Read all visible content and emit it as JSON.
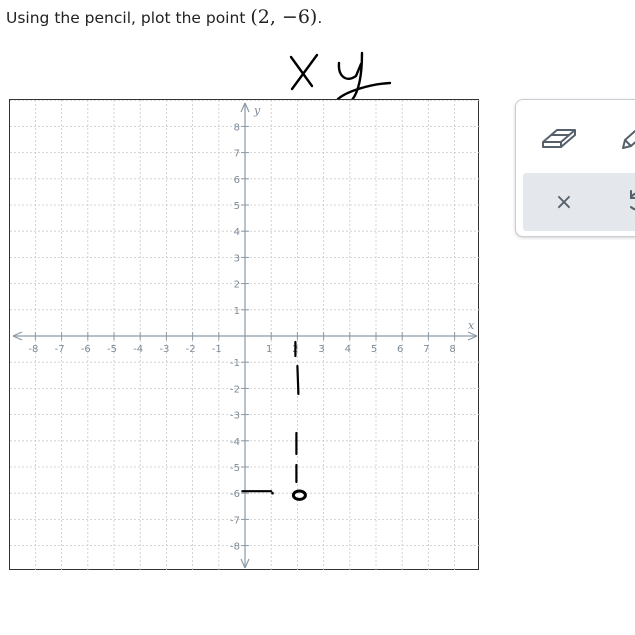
{
  "question": {
    "text": "Using the pencil, plot the point ",
    "point": "(2, −6)",
    "period": "."
  },
  "handwritten": {
    "label_x": "X",
    "label_y": "y"
  },
  "graph": {
    "x_axis_label": "x",
    "y_axis_label": "y",
    "x_range": [
      -9,
      9
    ],
    "y_range": [
      -9,
      9
    ],
    "x_tick_labels": [
      "-8",
      "-7",
      "-6",
      "-5",
      "-4",
      "-3",
      "-2",
      "-1",
      "1",
      "2",
      "3",
      "4",
      "5",
      "6",
      "7",
      "8"
    ],
    "y_tick_labels": [
      "8",
      "7",
      "6",
      "5",
      "4",
      "3",
      "2",
      "1",
      "-1",
      "-2",
      "-3",
      "-4",
      "-5",
      "-6",
      "-7",
      "-8"
    ],
    "plotted_point": {
      "x": 2,
      "y": -6
    },
    "colors": {
      "grid": "#c9c9c9",
      "axis": "#8a9aa8",
      "tick_text": "#7d8a96",
      "ink": "#000000"
    }
  },
  "tools": {
    "eraser": "eraser-icon",
    "pencil": "pencil-icon",
    "clear": "×",
    "undo": "undo-icon"
  }
}
